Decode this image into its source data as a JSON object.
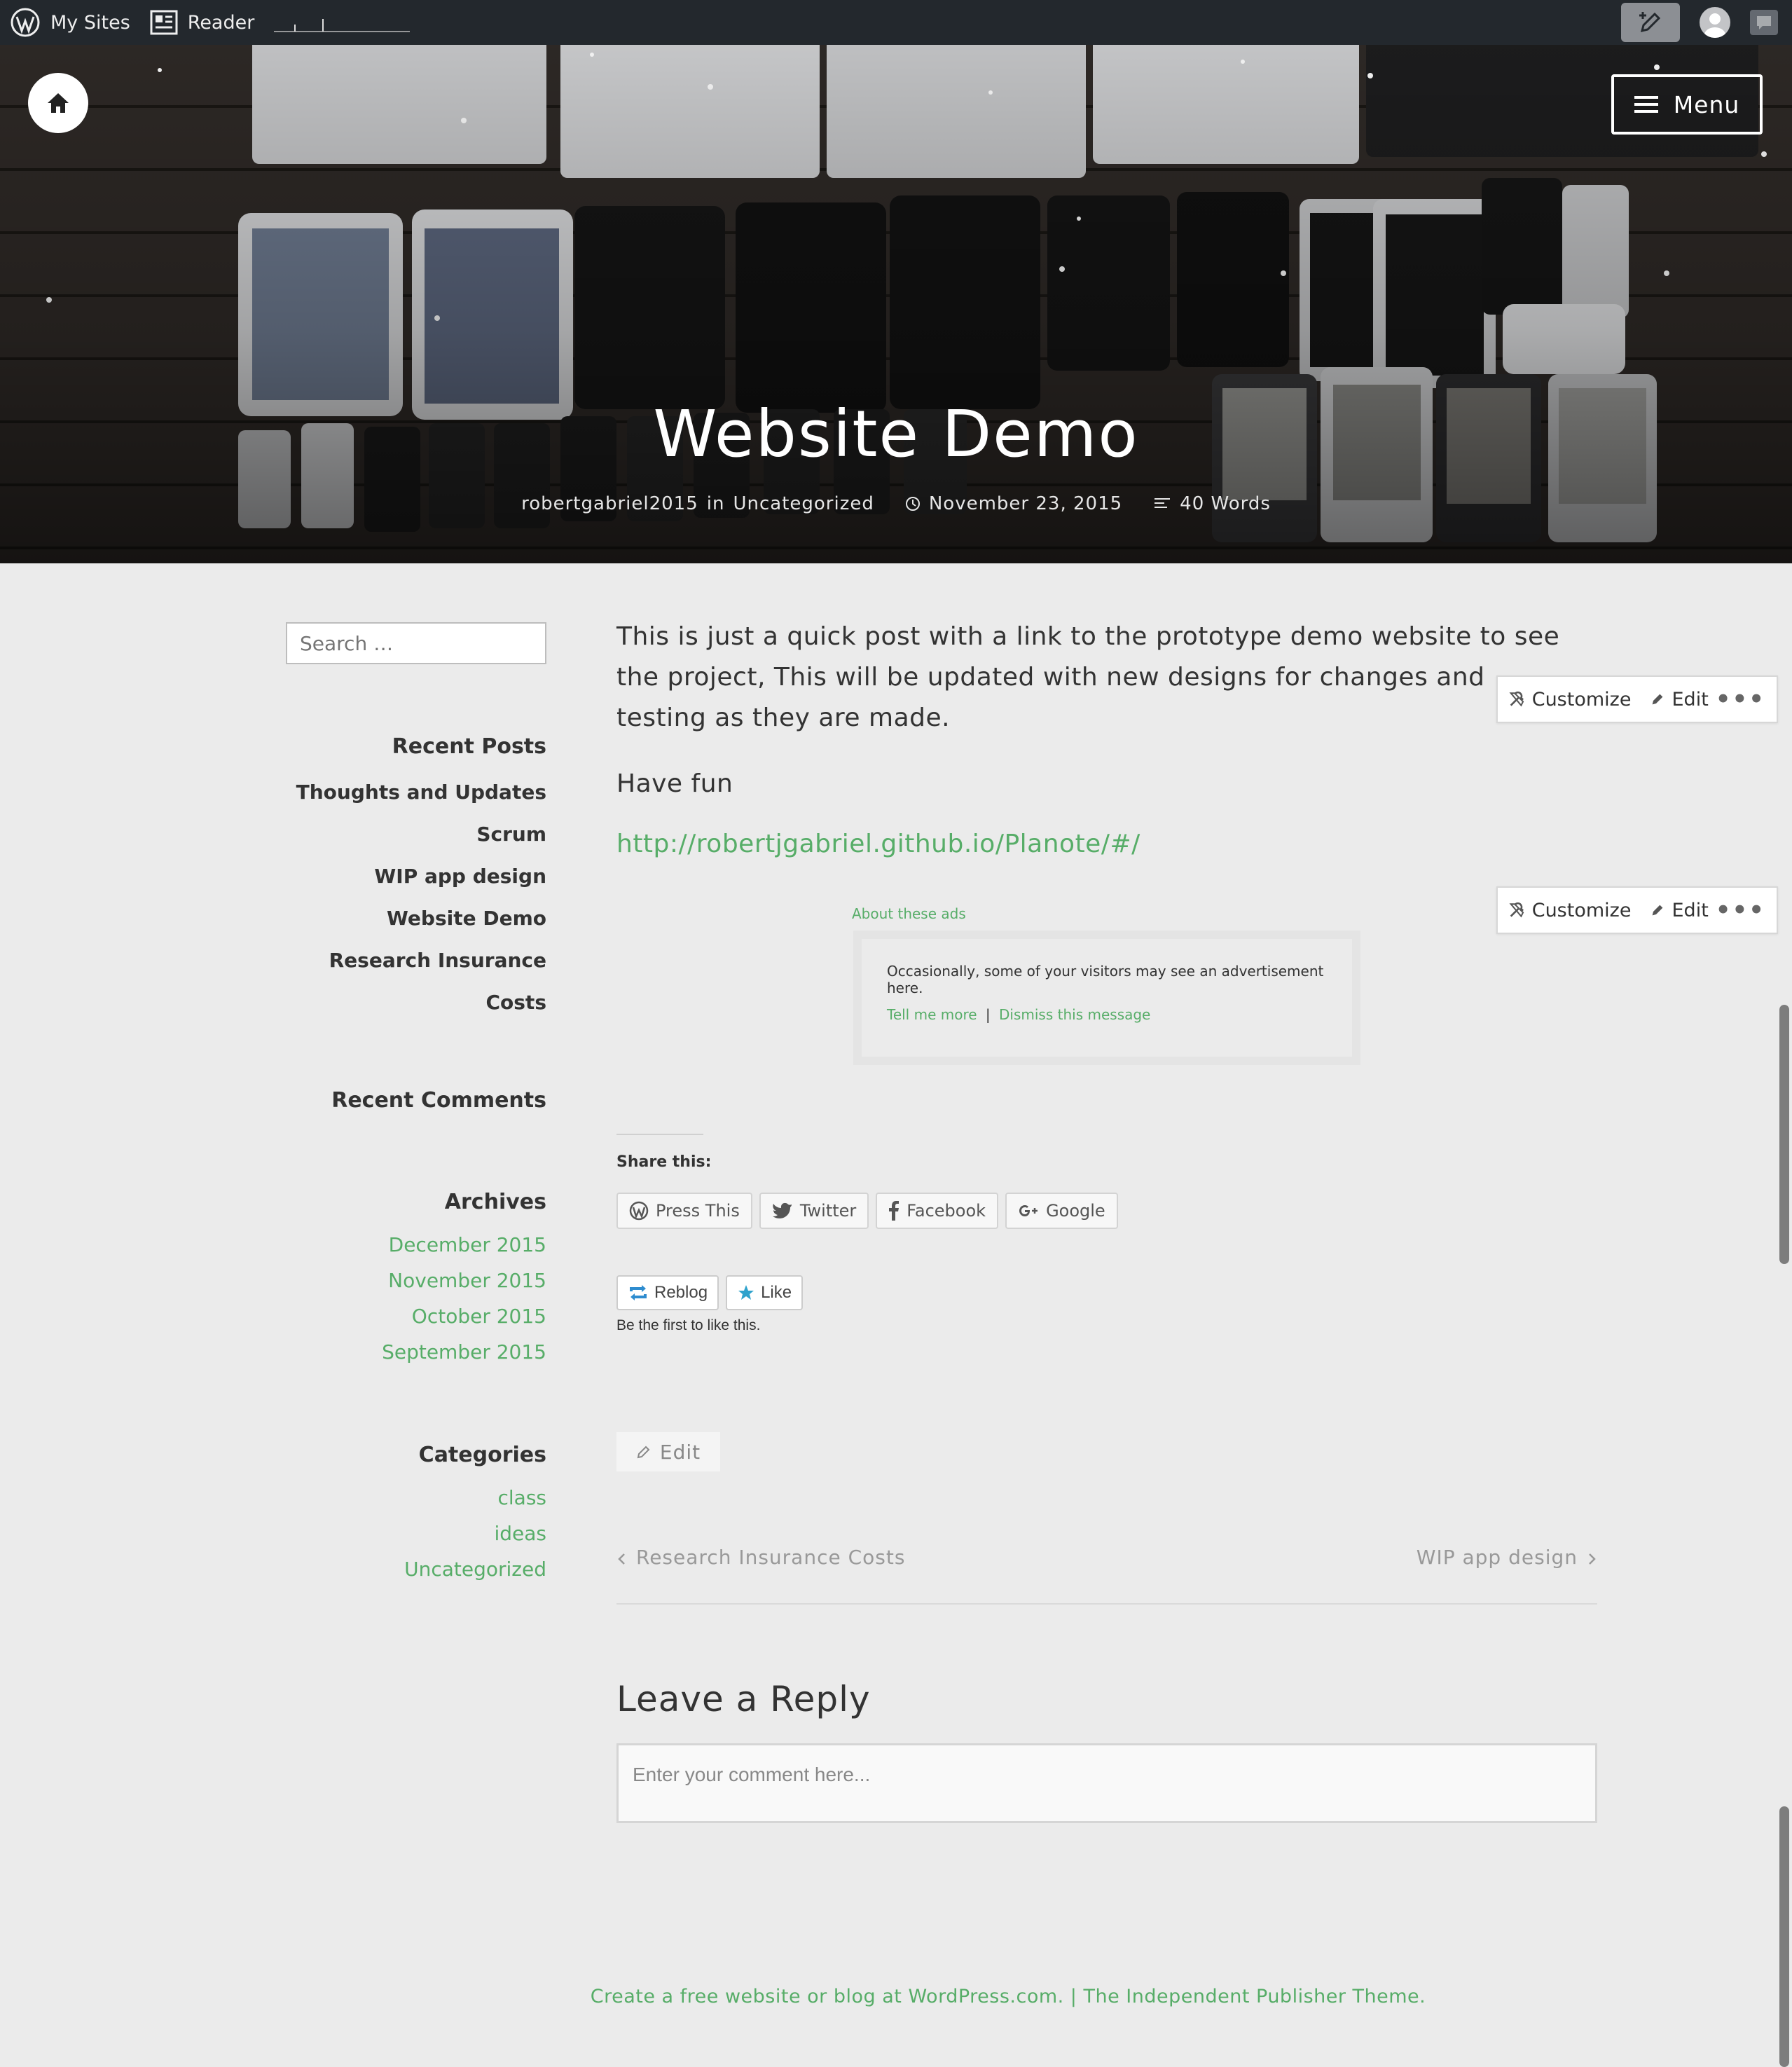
{
  "adminbar": {
    "my_sites": "My Sites",
    "reader": "Reader"
  },
  "hero": {
    "menu_label": "Menu",
    "title": "Website Demo",
    "author": "robertgabriel2015",
    "in_label": "in",
    "category": "Uncategorized",
    "date": "November 23, 2015",
    "word_count": "40 Words"
  },
  "sidebar": {
    "search_placeholder": "Search …",
    "recent_posts_title": "Recent Posts",
    "recent_posts": [
      "Thoughts and Updates",
      "Scrum",
      "WIP app design",
      "Website Demo",
      "Research Insurance Costs"
    ],
    "recent_comments_title": "Recent Comments",
    "archives_title": "Archives",
    "archives": [
      "December 2015",
      "November 2015",
      "October 2015",
      "September 2015"
    ],
    "categories_title": "Categories",
    "categories": [
      "class",
      "ideas",
      "Uncategorized"
    ]
  },
  "post": {
    "paragraph1": "This is just a quick post with a link to the prototype demo website to see the project, This will be updated with new designs for changes and testing as they are made.",
    "paragraph2": "Have fun",
    "link": "http://robertjgabriel.github.io/Planote/#/"
  },
  "customize_bar": {
    "customize": "Customize",
    "edit": "Edit",
    "more": "•••"
  },
  "ad": {
    "about": "About these ads",
    "text": "Occasionally, some of your visitors may see an advertisement here.",
    "tell_more": "Tell me more",
    "separator": "|",
    "dismiss": "Dismiss this message"
  },
  "share": {
    "title": "Share this:",
    "buttons": [
      "Press This",
      "Twitter",
      "Facebook",
      "Google"
    ]
  },
  "likes": {
    "reblog": "Reblog",
    "like": "Like",
    "first_like": "Be the first to like this."
  },
  "edit_label": "Edit",
  "post_nav": {
    "prev": "Research Insurance Costs",
    "next": "WIP app design"
  },
  "reply": {
    "title": "Leave a Reply",
    "placeholder": "Enter your comment here..."
  },
  "footer": {
    "text": "Create a free website or blog at WordPress.com. | The Independent Publisher Theme."
  },
  "colors": {
    "accent_green": "#57ad68",
    "adminbar": "#23282d",
    "background": "#ebebeb"
  }
}
